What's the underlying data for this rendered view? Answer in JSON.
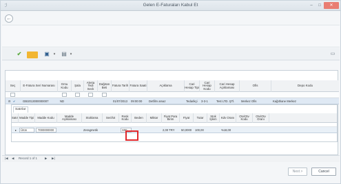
{
  "window": {
    "title": "Gelen E-Faturaları Kabul Et",
    "close_glyph": "✕",
    "min_glyph": "–",
    "max_glyph": "□"
  },
  "back_button": {
    "glyph": "←",
    "icon": "back-arrow-icon"
  },
  "toolbar": {
    "refresh_glyph": "✔",
    "save_glyph": "▣",
    "print_glyph": "▤",
    "dropdown_glyph": "▾",
    "layout_glyph": "▭"
  },
  "grid": {
    "headers": [
      "Seç",
      "E-Fatura Seri Numarası",
      "Grnu Kodu",
      "Şala",
      "Alerta Tedi Seck",
      "Dağıtan Beti",
      "Fatura Tarih",
      "Fatura Saati",
      "Açıklama",
      "Cari Hesap Tipi",
      "Cari Hesap Kodu",
      "Cari Hesap Açıklaması",
      "Ofis",
      "Depo Kodu"
    ],
    "row": {
      "invoice_no": "GBI2013000000007",
      "code": "ND",
      "date": "01/07/2013",
      "time": "09:00:00",
      "description": "Detfilm amaz",
      "account_type": "Tedarikçi",
      "account_code": "3-3-1",
      "account_desc": "Test LTD. ŞTİ.",
      "office": "Merkez Ofis",
      "depot": "Kağıthane Merkez"
    },
    "pager_text": "Record 1 of 1",
    "pager_first": "|◀",
    "pager_prev": "◀",
    "pager_next": "▶",
    "pager_last": "▶|"
  },
  "detail": {
    "tab_label": "Satırlar",
    "headers": [
      "Satır",
      "Madde Tipi",
      "Madde Kodu",
      "Madde Açıklaması",
      "Stoklama",
      "Seri/lot",
      "Renk Kodu",
      "Beden",
      "Miktar",
      "Fiyat Para Birim",
      "Fiyat",
      "Tutar",
      "Stok İşlem",
      "Kdv Oranı",
      "Otv/Otv Kodu",
      "Otv/Otv Oranı"
    ],
    "row": {
      "type": "Ürün",
      "code": "7000000000",
      "unit": "Zeragmetik",
      "serial": "S00",
      "quantity": "2,00 TRY",
      "price": "50,0000",
      "amount": "100,00",
      "vat": "%18,00"
    }
  },
  "footer": {
    "next_label": "Next >",
    "cancel_label": "Cancel"
  },
  "colors": {
    "highlight": "#e0262a",
    "selected_row": "#dfe9f4",
    "close_button": "#e97d72"
  }
}
